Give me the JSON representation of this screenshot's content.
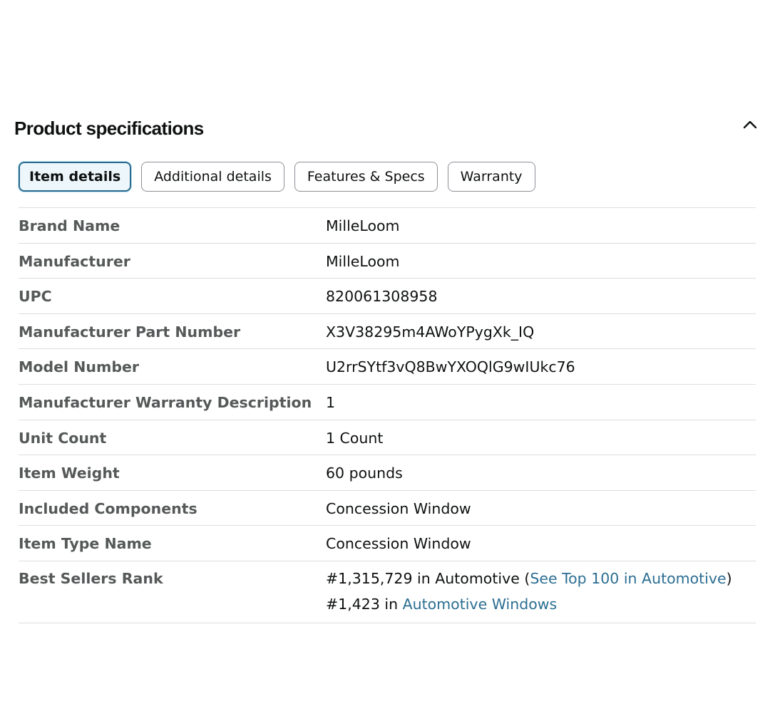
{
  "section": {
    "title": "Product specifications",
    "collapse_icon": "chevron-up-icon"
  },
  "tabs": [
    {
      "label": "Item details",
      "active": true
    },
    {
      "label": "Additional details",
      "active": false
    },
    {
      "label": "Features & Specs",
      "active": false
    },
    {
      "label": "Warranty",
      "active": false
    }
  ],
  "specs": [
    {
      "key": "Brand Name",
      "value": "MilleLoom"
    },
    {
      "key": "Manufacturer",
      "value": "MilleLoom"
    },
    {
      "key": "UPC",
      "value": "820061308958"
    },
    {
      "key": "Manufacturer Part Number",
      "value": "X3V38295m4AWoYPygXk_IQ"
    },
    {
      "key": "Model Number",
      "value": "U2rrSYtf3vQ8BwYXOQlG9wIUkc76"
    },
    {
      "key": "Manufacturer Warranty Description",
      "value": "1"
    },
    {
      "key": "Unit Count",
      "value": "1 Count"
    },
    {
      "key": "Item Weight",
      "value": "60 pounds"
    },
    {
      "key": "Included Components",
      "value": "Concession Window"
    },
    {
      "key": "Item Type Name",
      "value": "Concession Window"
    }
  ],
  "best_sellers": {
    "key": "Best Sellers Rank",
    "rank1_prefix": "#1,315,729 in Automotive (",
    "rank1_link": "See Top 100 in Automotive",
    "rank1_suffix": ")",
    "rank2_prefix": "#1,423 in ",
    "rank2_link": "Automotive Windows"
  },
  "colors": {
    "link": "#2c6e92",
    "active_tab_border": "#2a6b8f",
    "key_text": "#565959"
  }
}
